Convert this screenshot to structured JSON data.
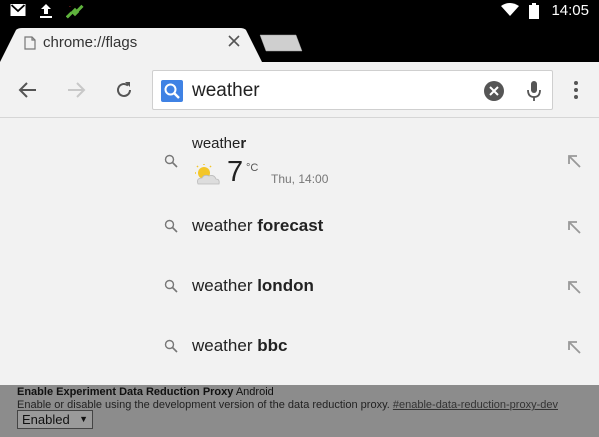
{
  "status_bar": {
    "time": "14:05",
    "icons": [
      "gmail-icon",
      "upload-icon",
      "satellite-icon",
      "wifi-icon",
      "battery-icon"
    ]
  },
  "tab": {
    "title": "chrome://flags",
    "icon": "page-icon"
  },
  "toolbar": {
    "omnibox_value": "weather",
    "icons": [
      "back-arrow-icon",
      "forward-arrow-icon",
      "reload-icon",
      "search-icon",
      "clear-icon",
      "microphone-icon",
      "overflow-menu-icon"
    ]
  },
  "suggestions": [
    {
      "prefix": "weathe",
      "bold": "r",
      "kind": "weather-answer"
    },
    {
      "prefix": "weather ",
      "bold": "forecast"
    },
    {
      "prefix": "weather ",
      "bold": "london"
    },
    {
      "prefix": "weather ",
      "bold": "bbc"
    }
  ],
  "weather": {
    "temperature": "7",
    "unit": "°C",
    "timestamp": "Thu, 14:00",
    "condition_icon": "partly-cloudy-icon"
  },
  "flag": {
    "title": "Enable Experiment Data Reduction Proxy",
    "platform": "Android",
    "description": "Enable or disable using the development version of the data reduction proxy.",
    "anchor": "#enable-data-reduction-proxy-dev",
    "selected": "Enabled"
  },
  "colors": {
    "accent_search_blue": "#3f82e4",
    "status_bar": "#000000",
    "background": "#f2f2f2",
    "dim_overlay": "#8c8c8c"
  }
}
